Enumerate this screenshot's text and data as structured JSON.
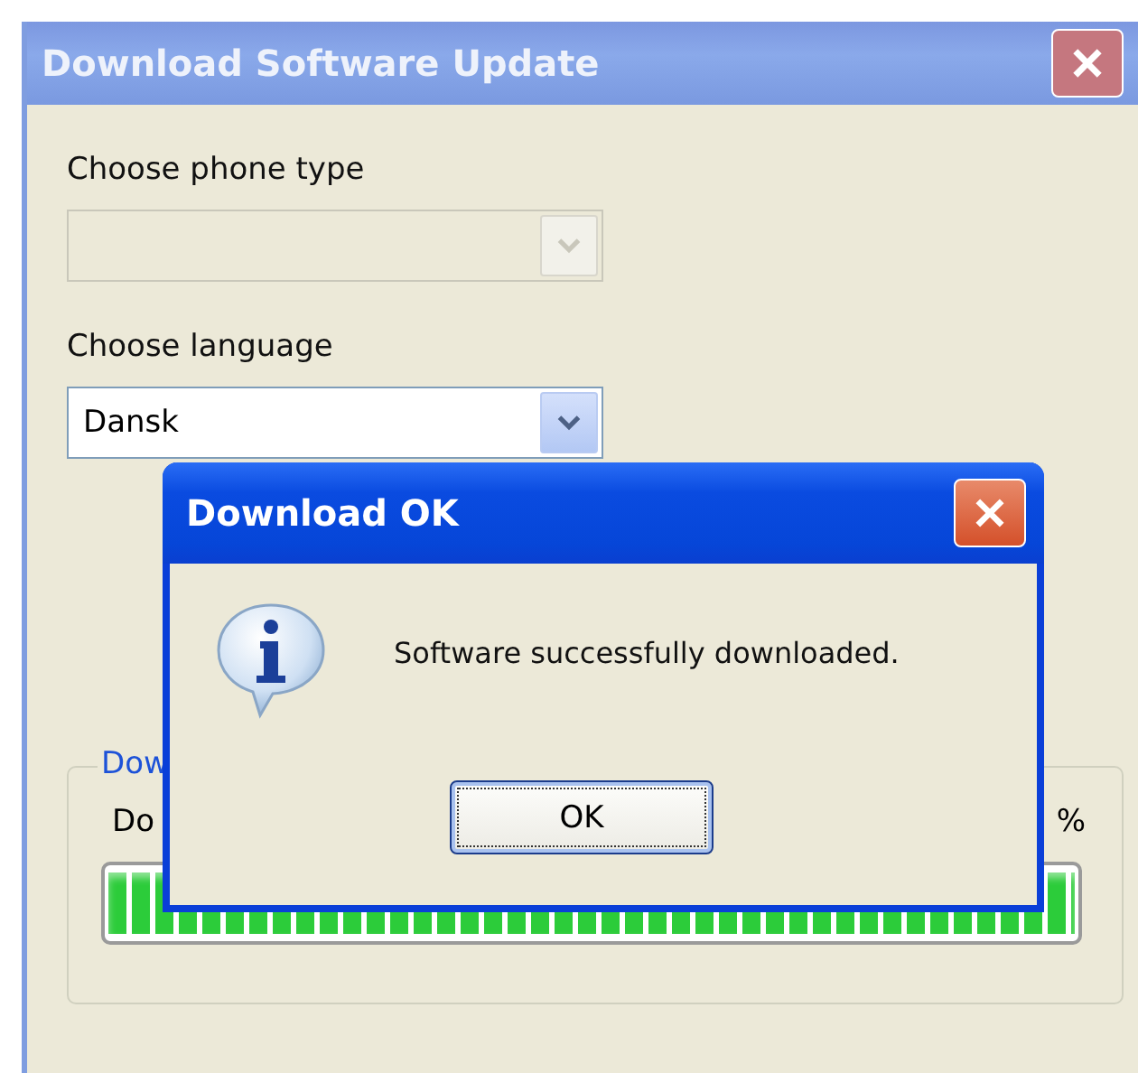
{
  "window": {
    "title": "Download Software Update"
  },
  "phone_type": {
    "label": "Choose phone type",
    "disabled": true
  },
  "language": {
    "label": "Choose language",
    "value": "Dansk",
    "disabled": false
  },
  "download_group": {
    "legend": "Dow",
    "status_text": "Do",
    "percent": "%",
    "level": 1
  },
  "dialog": {
    "title": "Download OK",
    "message": "Software successfully downloaded.",
    "buttons": [
      "OK"
    ]
  }
}
